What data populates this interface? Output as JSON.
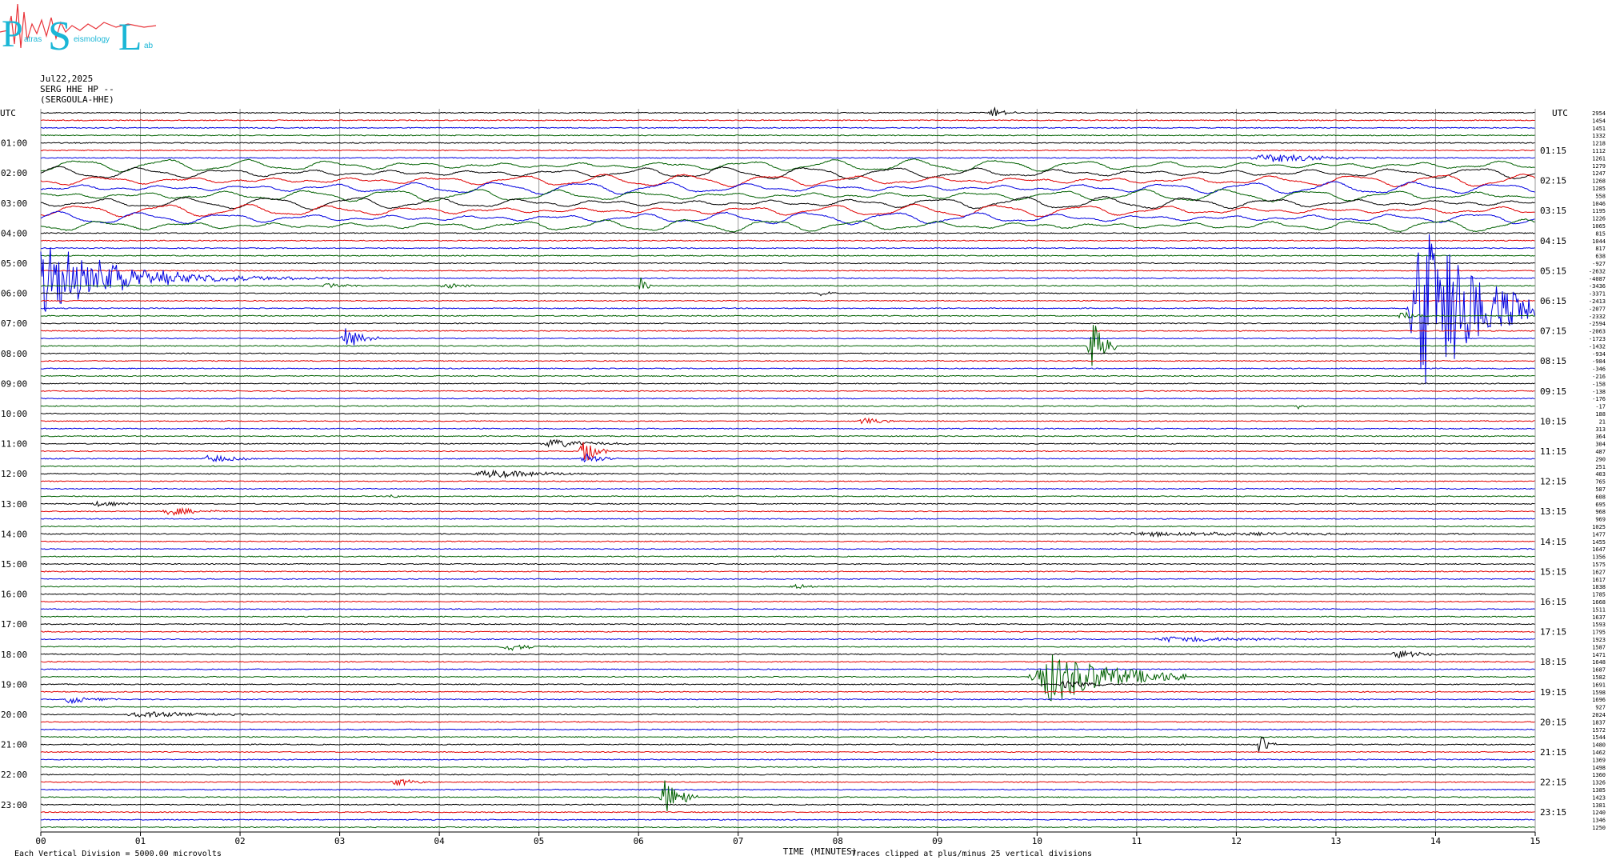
{
  "logo": {
    "letters": [
      "P",
      "S",
      "L"
    ],
    "small_words": [
      "atras",
      "eismology",
      "ab"
    ],
    "colors": {
      "letters": "#1ab6d6",
      "trace": "#e8343a"
    }
  },
  "header": {
    "date": "Jul22,2025",
    "channel": "SERG HHE HP --",
    "station": "(SERGOULA-HHE)"
  },
  "axes": {
    "utc_left_label": "UTC",
    "utc_right_label": "UTC",
    "left_hour_labels": [
      "01:00",
      "02:00",
      "03:00",
      "04:00",
      "05:00",
      "06:00",
      "07:00",
      "08:00",
      "09:00",
      "10:00",
      "11:00",
      "12:00",
      "13:00",
      "14:00",
      "15:00",
      "16:00",
      "17:00",
      "18:00",
      "19:00",
      "20:00",
      "21:00",
      "22:00",
      "23:00"
    ],
    "right_hour_labels": [
      "01:15",
      "02:15",
      "03:15",
      "04:15",
      "05:15",
      "06:15",
      "07:15",
      "08:15",
      "09:15",
      "10:15",
      "11:15",
      "12:15",
      "13:15",
      "14:15",
      "15:15",
      "16:15",
      "17:15",
      "18:15",
      "19:15",
      "20:15",
      "21:15",
      "22:15",
      "23:15"
    ],
    "minute_ticks": [
      "00",
      "01",
      "02",
      "03",
      "04",
      "05",
      "06",
      "07",
      "08",
      "09",
      "10",
      "11",
      "12",
      "13",
      "14",
      "15"
    ],
    "x_title": "TIME (MINUTES)"
  },
  "footer": {
    "scale_note": "Each Vertical Division = 5000.00 microvolts",
    "clip_note": "Traces clipped at plus/minus 25 vertical divisions"
  },
  "chart_data": {
    "type": "line",
    "title": "",
    "xlabel": "TIME (MINUTES)",
    "ylabel": "",
    "xlim": [
      0,
      15
    ],
    "rows": 96,
    "row_minutes": 15,
    "series_colors": [
      "#000000",
      "#e00000",
      "#0000e0",
      "#006000"
    ],
    "grid": true,
    "right_offsets": [
      "2954",
      "1454",
      "1451",
      "1332",
      "1218",
      "1112",
      "1261",
      "1279",
      "1247",
      "1268",
      "1285",
      "558",
      "1046",
      "1195",
      "1226",
      "1065",
      "815",
      "1044",
      "817",
      "638",
      "-927",
      "-2632",
      "-4087",
      "-3436",
      "-3371",
      "-2413",
      "-2077",
      "-2332",
      "-2594",
      "-2063",
      "-1723",
      "-1432",
      "-934",
      "-984",
      "-346",
      "-216",
      "-158",
      "-138",
      "-176",
      "-17",
      "188",
      "21",
      "313",
      "364",
      "304",
      "487",
      "290",
      "251",
      "403",
      "765",
      "587",
      "608",
      "695",
      "968",
      "969",
      "1025",
      "1477",
      "1455",
      "1647",
      "1356",
      "1575",
      "1627",
      "1617",
      "1838",
      "1785",
      "1668",
      "1511",
      "1637",
      "1593",
      "1795",
      "1923",
      "1587",
      "1471",
      "1648",
      "1687",
      "1582",
      "1691",
      "1598",
      "1696",
      "927",
      "2024",
      "1837",
      "1572",
      "1544",
      "1480",
      "1462",
      "1369",
      "1498",
      "1360",
      "1326",
      "1385",
      "1423",
      "1381",
      "1240",
      "1346",
      "1250"
    ],
    "events": [
      {
        "row": 0,
        "minute": 9.5,
        "amp": 0.8,
        "dur": 0.3,
        "kind": "burst"
      },
      {
        "row": 6,
        "minute": 12.1,
        "amp": 0.6,
        "dur": 1.5,
        "kind": "burst"
      },
      {
        "row": 23,
        "minute": 2.8,
        "amp": 0.4,
        "dur": 0.5,
        "kind": "burst"
      },
      {
        "row": 23,
        "minute": 4.0,
        "amp": 0.4,
        "dur": 0.5,
        "kind": "burst"
      },
      {
        "row": 23,
        "minute": 6.0,
        "amp": 1.2,
        "dur": 0.15,
        "kind": "burst"
      },
      {
        "row": 24,
        "minute": 7.8,
        "amp": 0.4,
        "dur": 0.2,
        "kind": "burst"
      },
      {
        "row": 27,
        "minute": 13.6,
        "amp": 0.6,
        "dur": 0.4,
        "kind": "burst"
      },
      {
        "row": 30,
        "minute": 3.0,
        "amp": 1.5,
        "dur": 0.4,
        "kind": "burst"
      },
      {
        "row": 31,
        "minute": 10.5,
        "amp": 4.0,
        "dur": 0.3,
        "kind": "burst"
      },
      {
        "row": 39,
        "minute": 12.6,
        "amp": 0.4,
        "dur": 0.1,
        "kind": "burst"
      },
      {
        "row": 41,
        "minute": 8.2,
        "amp": 0.5,
        "dur": 0.4,
        "kind": "burst"
      },
      {
        "row": 44,
        "minute": 5.0,
        "amp": 0.6,
        "dur": 0.9,
        "kind": "burst"
      },
      {
        "row": 45,
        "minute": 5.4,
        "amp": 2.0,
        "dur": 0.3,
        "kind": "burst"
      },
      {
        "row": 46,
        "minute": 1.6,
        "amp": 0.6,
        "dur": 0.6,
        "kind": "burst"
      },
      {
        "row": 46,
        "minute": 5.4,
        "amp": 0.8,
        "dur": 0.4,
        "kind": "burst"
      },
      {
        "row": 48,
        "minute": 4.3,
        "amp": 0.6,
        "dur": 1.3,
        "kind": "burst"
      },
      {
        "row": 51,
        "minute": 3.5,
        "amp": 0.6,
        "dur": 0.15,
        "kind": "burst"
      },
      {
        "row": 52,
        "minute": 0.5,
        "amp": 0.4,
        "dur": 0.5,
        "kind": "burst"
      },
      {
        "row": 53,
        "minute": 1.2,
        "amp": 0.6,
        "dur": 0.7,
        "kind": "burst"
      },
      {
        "row": 56,
        "minute": 10.6,
        "amp": 0.3,
        "dur": 4.0,
        "kind": "burst"
      },
      {
        "row": 63,
        "minute": 7.5,
        "amp": 0.3,
        "dur": 0.5,
        "kind": "burst"
      },
      {
        "row": 70,
        "minute": 11.1,
        "amp": 0.4,
        "dur": 1.8,
        "kind": "burst"
      },
      {
        "row": 71,
        "minute": 4.6,
        "amp": 0.5,
        "dur": 0.6,
        "kind": "burst"
      },
      {
        "row": 72,
        "minute": 13.5,
        "amp": 0.5,
        "dur": 0.8,
        "kind": "burst"
      },
      {
        "row": 75,
        "minute": 9.9,
        "amp": 3.5,
        "dur": 1.6,
        "kind": "burst"
      },
      {
        "row": 76,
        "minute": 10.2,
        "amp": 0.6,
        "dur": 0.6,
        "kind": "burst"
      },
      {
        "row": 78,
        "minute": 0.2,
        "amp": 0.6,
        "dur": 0.6,
        "kind": "burst"
      },
      {
        "row": 80,
        "minute": 0.8,
        "amp": 0.4,
        "dur": 1.6,
        "kind": "burst"
      },
      {
        "row": 84,
        "minute": 12.2,
        "amp": 1.5,
        "dur": 0.2,
        "kind": "burst"
      },
      {
        "row": 89,
        "minute": 3.5,
        "amp": 0.5,
        "dur": 0.5,
        "kind": "burst"
      },
      {
        "row": 91,
        "minute": 6.2,
        "amp": 2.5,
        "dur": 0.4,
        "kind": "burst"
      },
      {
        "row": 26,
        "minute": 13.7,
        "amp": 12.0,
        "dur": 1.3,
        "kind": "burst"
      },
      {
        "row": 22,
        "minute": 0.0,
        "amp": 4.0,
        "dur": 4.0,
        "kind": "coda"
      }
    ],
    "teleseism_rows": [
      7,
      8,
      9,
      10,
      11,
      12,
      13,
      14,
      15
    ]
  }
}
